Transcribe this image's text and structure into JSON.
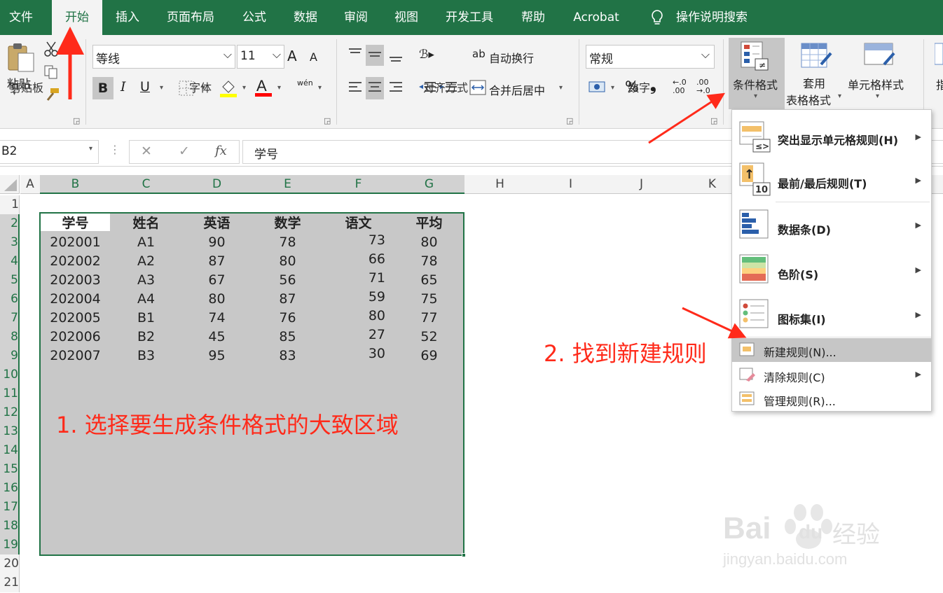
{
  "tabs": [
    {
      "label": "文件",
      "active": false
    },
    {
      "label": "开始",
      "active": true
    },
    {
      "label": "插入",
      "active": false
    },
    {
      "label": "页面布局",
      "active": false
    },
    {
      "label": "公式",
      "active": false
    },
    {
      "label": "数据",
      "active": false
    },
    {
      "label": "审阅",
      "active": false
    },
    {
      "label": "视图",
      "active": false
    },
    {
      "label": "开发工具",
      "active": false
    },
    {
      "label": "帮助",
      "active": false
    },
    {
      "label": "Acrobat",
      "active": false
    }
  ],
  "tell_me": {
    "label": "操作说明搜索",
    "icon": "lightbulb-icon"
  },
  "ribbon": {
    "clipboard": {
      "label": "剪贴板",
      "paste": "粘贴"
    },
    "font": {
      "label": "字体",
      "name": "等线",
      "size": "11",
      "grow": "A",
      "shrink": "A",
      "bold": "B",
      "italic": "I",
      "underline": "U",
      "phonetic": "wén"
    },
    "alignment": {
      "label": "对齐方式",
      "wrap": "自动换行",
      "merge": "合并后居中"
    },
    "number": {
      "label": "数字",
      "format": "常规",
      "percent": "%",
      "comma": "❟",
      "inc_dec": "←.0 .00",
      "dec_dec": ".00 →.0"
    },
    "styles": {
      "conditional": "条件格式",
      "table_line1": "套用",
      "table_line2": "表格格式",
      "cell": "单元格样式",
      "partial": "指"
    }
  },
  "formula_bar": {
    "name_box": "B2",
    "fx": "fx",
    "value": "学号",
    "cancel": "✕",
    "enter": "✓"
  },
  "columns": [
    "A",
    "B",
    "C",
    "D",
    "E",
    "F",
    "G",
    "H",
    "I",
    "J",
    "K"
  ],
  "rows": [
    "1",
    "2",
    "3",
    "4",
    "5",
    "6",
    "7",
    "8",
    "9",
    "10",
    "11",
    "12",
    "13",
    "14",
    "15",
    "16",
    "17",
    "18",
    "19",
    "20",
    "21"
  ],
  "table": {
    "headers": [
      "学号",
      "姓名",
      "英语",
      "数学",
      "语文",
      "平均"
    ],
    "rows": [
      [
        "202001",
        "A1",
        "90",
        "78",
        "73",
        "80"
      ],
      [
        "202002",
        "A2",
        "87",
        "80",
        "66",
        "78"
      ],
      [
        "202003",
        "A3",
        "67",
        "56",
        "71",
        "65"
      ],
      [
        "202004",
        "A4",
        "80",
        "87",
        "59",
        "75"
      ],
      [
        "202005",
        "B1",
        "74",
        "76",
        "80",
        "77"
      ],
      [
        "202006",
        "B2",
        "45",
        "85",
        "27",
        "52"
      ],
      [
        "202007",
        "B3",
        "95",
        "83",
        "30",
        "69"
      ]
    ]
  },
  "menu": {
    "items": [
      {
        "label": "突出显示单元格规则(H)",
        "submenu": true
      },
      {
        "label": "最前/最后规则(T)",
        "submenu": true
      },
      {
        "label": "数据条(D)",
        "submenu": true
      },
      {
        "label": "色阶(S)",
        "submenu": true
      },
      {
        "label": "图标集(I)",
        "submenu": true
      }
    ],
    "small_items": [
      {
        "label": "新建规则(N)...",
        "submenu": false,
        "highlighted": true
      },
      {
        "label": "清除规则(C)",
        "submenu": true,
        "highlighted": false
      },
      {
        "label": "管理规则(R)...",
        "submenu": false,
        "highlighted": false
      }
    ],
    "icon_texts": {
      "not_equal": "≠",
      "lte": "≤>",
      "ten": "10",
      "up": "↑"
    }
  },
  "annotations": {
    "step1": "1. 选择要生成条件格式的大致区域",
    "step2": "2. 找到新建规则"
  },
  "watermark": {
    "brand": "Bai",
    "mid": "du",
    "cn": "经验",
    "url": "jingyan.baidu.com"
  },
  "colors": {
    "excel_green": "#217346",
    "annotation_red": "#ff2a1a",
    "selection_gray": "#c8c8c8"
  }
}
